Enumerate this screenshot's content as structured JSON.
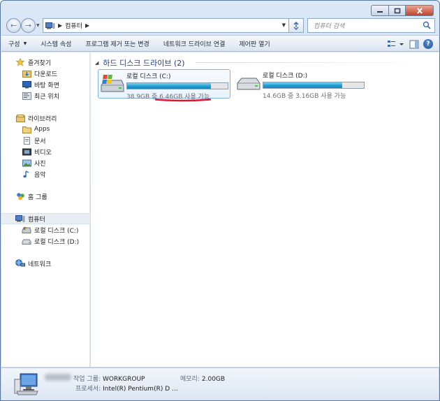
{
  "window": {
    "caption_buttons": [
      "minimize",
      "maximize",
      "close"
    ]
  },
  "nav": {
    "breadcrumb": [
      "컴퓨터"
    ],
    "search_placeholder": "컴퓨터 검색"
  },
  "toolbar": {
    "items": [
      {
        "label": "구성",
        "dropdown": true
      },
      {
        "label": "시스템 속성"
      },
      {
        "label": "프로그램 제거 또는 변경"
      },
      {
        "label": "네트워크 드라이브 연결"
      },
      {
        "label": "제어판 열기"
      }
    ]
  },
  "sidebar": {
    "favorites": {
      "label": "즐겨찾기",
      "icon": "star-icon"
    },
    "favorites_items": [
      {
        "label": "다운로드",
        "icon": "downloads-folder-icon"
      },
      {
        "label": "바탕 화면",
        "icon": "desktop-icon"
      },
      {
        "label": "최근 위치",
        "icon": "recent-places-icon"
      }
    ],
    "libraries": {
      "label": "라이브러리",
      "icon": "library-icon"
    },
    "libraries_items": [
      {
        "label": "Apps",
        "icon": "folder-icon"
      },
      {
        "label": "문서",
        "icon": "documents-icon"
      },
      {
        "label": "비디오",
        "icon": "video-icon"
      },
      {
        "label": "사진",
        "icon": "pictures-icon"
      },
      {
        "label": "음악",
        "icon": "music-icon"
      }
    ],
    "homegroup": {
      "label": "홈 그룹",
      "icon": "homegroup-icon"
    },
    "computer": {
      "label": "컴퓨터",
      "icon": "computer-icon",
      "selected": true
    },
    "computer_items": [
      {
        "label": "로컬 디스크 (C:)",
        "icon": "system-drive-icon"
      },
      {
        "label": "로컬 디스크 (D:)",
        "icon": "drive-icon"
      }
    ],
    "network": {
      "label": "네트워크",
      "icon": "network-icon"
    }
  },
  "content": {
    "group_title": "하드 디스크 드라이브 (2)",
    "drives": [
      {
        "name": "로컬 디스크 (C:)",
        "free_text": "38.9GB 중 6.46GB 사용 가능",
        "used_fraction": 0.834,
        "selected": true
      },
      {
        "name": "로컬 디스크 (D:)",
        "free_text": "14.6GB 중 3.16GB 사용 가능",
        "used_fraction": 0.784,
        "selected": false
      }
    ],
    "accent_color": "#1b9fd2",
    "annotation_color": "#d8172c"
  },
  "details": {
    "workgroup_label": "작업 그룹:",
    "workgroup_value": "WORKGROUP",
    "memory_label": "메모리:",
    "memory_value": "2.00GB",
    "processor_label": "프로세서:",
    "processor_value": "Intel(R) Pentium(R) D ..."
  }
}
